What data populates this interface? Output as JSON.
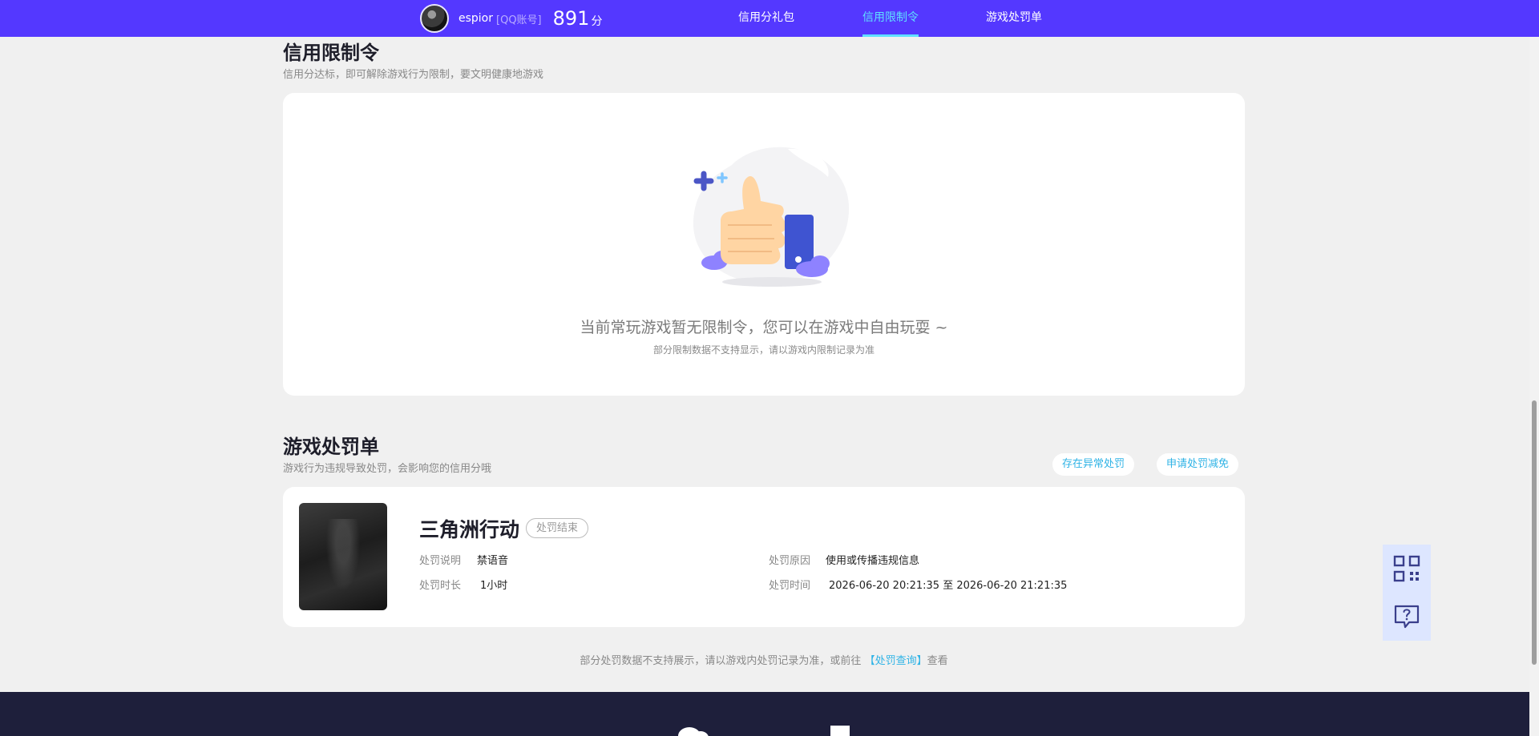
{
  "header": {
    "username": "espior",
    "account_type": "[QQ账号]",
    "score": "891",
    "score_unit": "分",
    "nav": [
      {
        "label": "信用分礼包",
        "active": false
      },
      {
        "label": "信用限制令",
        "active": true
      },
      {
        "label": "游戏处罚单",
        "active": false
      }
    ]
  },
  "restriction": {
    "title": "信用限制令",
    "subtitle": "信用分达标，即可解除游戏行为限制，要文明健康地游戏",
    "empty_message": "当前常玩游戏暂无限制令，您可以在游戏中自由玩耍 ~",
    "empty_note": "部分限制数据不支持显示，请以游戏内限制记录为准"
  },
  "punishment": {
    "title": "游戏处罚单",
    "subtitle": "游戏行为违规导致处罚，会影响您的信用分哦",
    "actions": {
      "abnormal": "存在异常处罚",
      "appeal": "申请处罚减免"
    },
    "record": {
      "game_name": "三角洲行动",
      "status": "处罚结束",
      "desc_label": "处罚说明",
      "desc_value": "禁语音",
      "duration_label": "处罚时长",
      "duration_value": "1小时",
      "reason_label": "处罚原因",
      "reason_value": "使用或传播违规信息",
      "time_label": "处罚时间",
      "time_value": "2026-06-20 20:21:35 至 2026-06-20 21:21:35"
    },
    "note_prefix": "部分处罚数据不支持展示，请以游戏内处罚记录为准，或前往",
    "note_link": "【处罚查询】",
    "note_suffix": "查看"
  },
  "floating": {
    "qr_icon": "qr-code-icon",
    "help_icon": "help-chat-icon"
  },
  "colors": {
    "nav_bg": "#5438ff",
    "nav_active": "#5fe0ff",
    "link": "#2fb3e6",
    "footer_bg": "#1e1f3b"
  }
}
